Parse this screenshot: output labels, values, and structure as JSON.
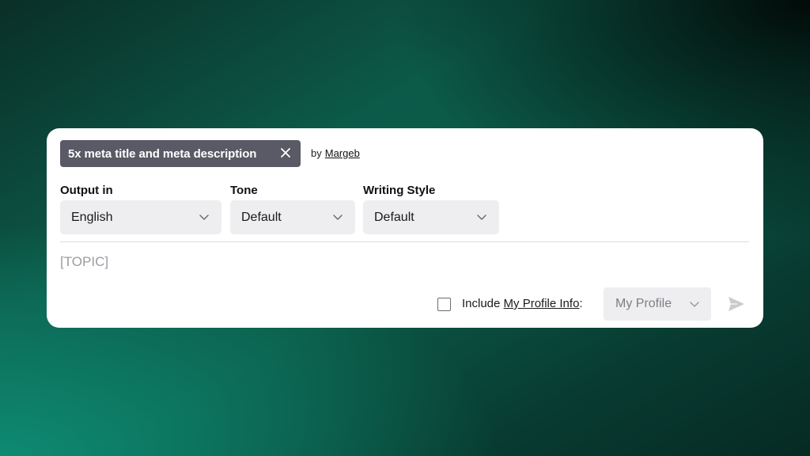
{
  "prompt": {
    "title": "5x meta title and meta description",
    "by_label": "by",
    "author": "Margeb"
  },
  "options": {
    "output": {
      "label": "Output in",
      "value": "English"
    },
    "tone": {
      "label": "Tone",
      "value": "Default"
    },
    "style": {
      "label": "Writing Style",
      "value": "Default"
    }
  },
  "input": {
    "placeholder": "[TOPIC]",
    "value": ""
  },
  "footer": {
    "include_prefix": "Include",
    "include_link": "My Profile Info",
    "include_suffix": ":",
    "profile_select": "My Profile",
    "checkbox_checked": false
  },
  "icons": {
    "close": "close-icon",
    "chevron": "chevron-down-icon",
    "send": "send-icon"
  },
  "colors": {
    "tag_bg": "#5a5a66",
    "select_bg": "#eeeef1",
    "send_icon": "#c9c9cf"
  }
}
